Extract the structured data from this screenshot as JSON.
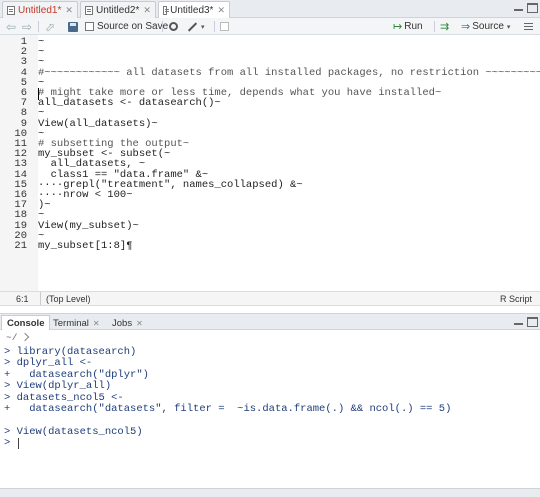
{
  "tabs": [
    {
      "name": "Untitled1*",
      "unsaved": true,
      "active": false
    },
    {
      "name": "Untitled2*",
      "unsaved": false,
      "active": false
    },
    {
      "name": "Untitled3*",
      "unsaved": false,
      "active": true
    }
  ],
  "toolbar": {
    "source_on_save": "Source on Save",
    "run": "Run",
    "source": "Source"
  },
  "editor": {
    "line_numbers": [
      "1",
      "2",
      "3",
      "4",
      "5",
      "6",
      "7",
      "8",
      "9",
      "10",
      "11",
      "12",
      "13",
      "14",
      "15",
      "16",
      "17",
      "18",
      "19",
      "20",
      "21"
    ],
    "lines": [
      "~",
      "~",
      "~",
      "#~~~~~~~~~~~~ all datasets from all installed packages, no restriction ~~~~~~~~~~",
      "~",
      "# might take more or less time, depends what you have installed~",
      "all_datasets <- datasearch()~",
      "~",
      "View(all_datasets)~",
      "~",
      "# subsetting the output~",
      "my_subset <- subset(~",
      "  all_datasets, ~",
      "  class1 == \"data.frame\" &~",
      "····grepl(\"treatment\", names_collapsed) &~",
      "····nrow < 100~",
      ")~",
      "~",
      "View(my_subset)~",
      "~",
      "my_subset[1:8]¶"
    ],
    "comment_lines": [
      3,
      5,
      10
    ]
  },
  "editor_status": {
    "position": "6:1",
    "scope": "(Top Level)",
    "file_type": "R Script"
  },
  "console_tabs": [
    {
      "label": "Console",
      "active": true
    },
    {
      "label": "Terminal",
      "active": false
    },
    {
      "label": "Jobs",
      "active": false
    }
  ],
  "console": {
    "path": "~/",
    "lines": [
      "> library(datasearch)",
      "> dplyr_all <-",
      "+   datasearch(\"dplyr\")",
      "> View(dplyr_all)",
      "> datasets_ncol5 <-",
      "+   datasearch(\"datasets\", filter =  ~is.data.frame(.) && ncol(.) == 5)",
      "",
      "> View(datasets_ncol5)",
      "> "
    ]
  }
}
